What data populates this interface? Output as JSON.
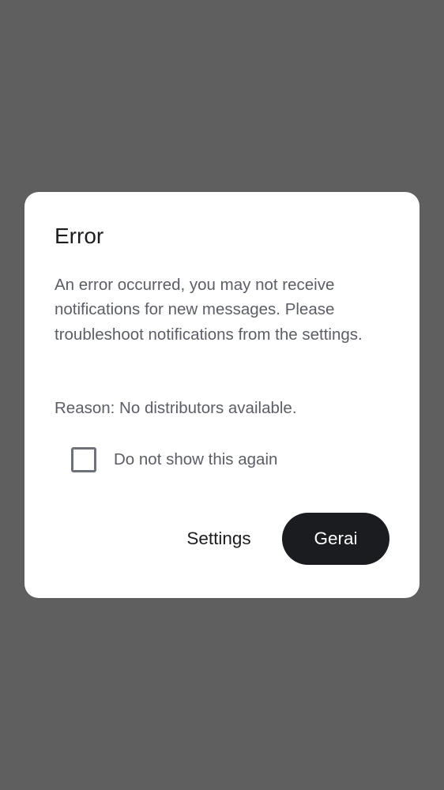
{
  "colors": {
    "scrim": "#5f5f5f",
    "dialog_background": "#ffffff",
    "primary_button": "#1b1c20",
    "text_primary": "#1b1c1f",
    "text_secondary": "#5b5e66"
  },
  "dialog": {
    "title": "Error",
    "message": "An error occurred, you may not receive notifications for new messages. Please troubleshoot notifications from the settings.",
    "reason": "Reason: No distributors available.",
    "checkbox": {
      "label": "Do not show this again",
      "checked": false
    },
    "buttons": {
      "settings_label": "Settings",
      "confirm_label": "Gerai"
    }
  }
}
